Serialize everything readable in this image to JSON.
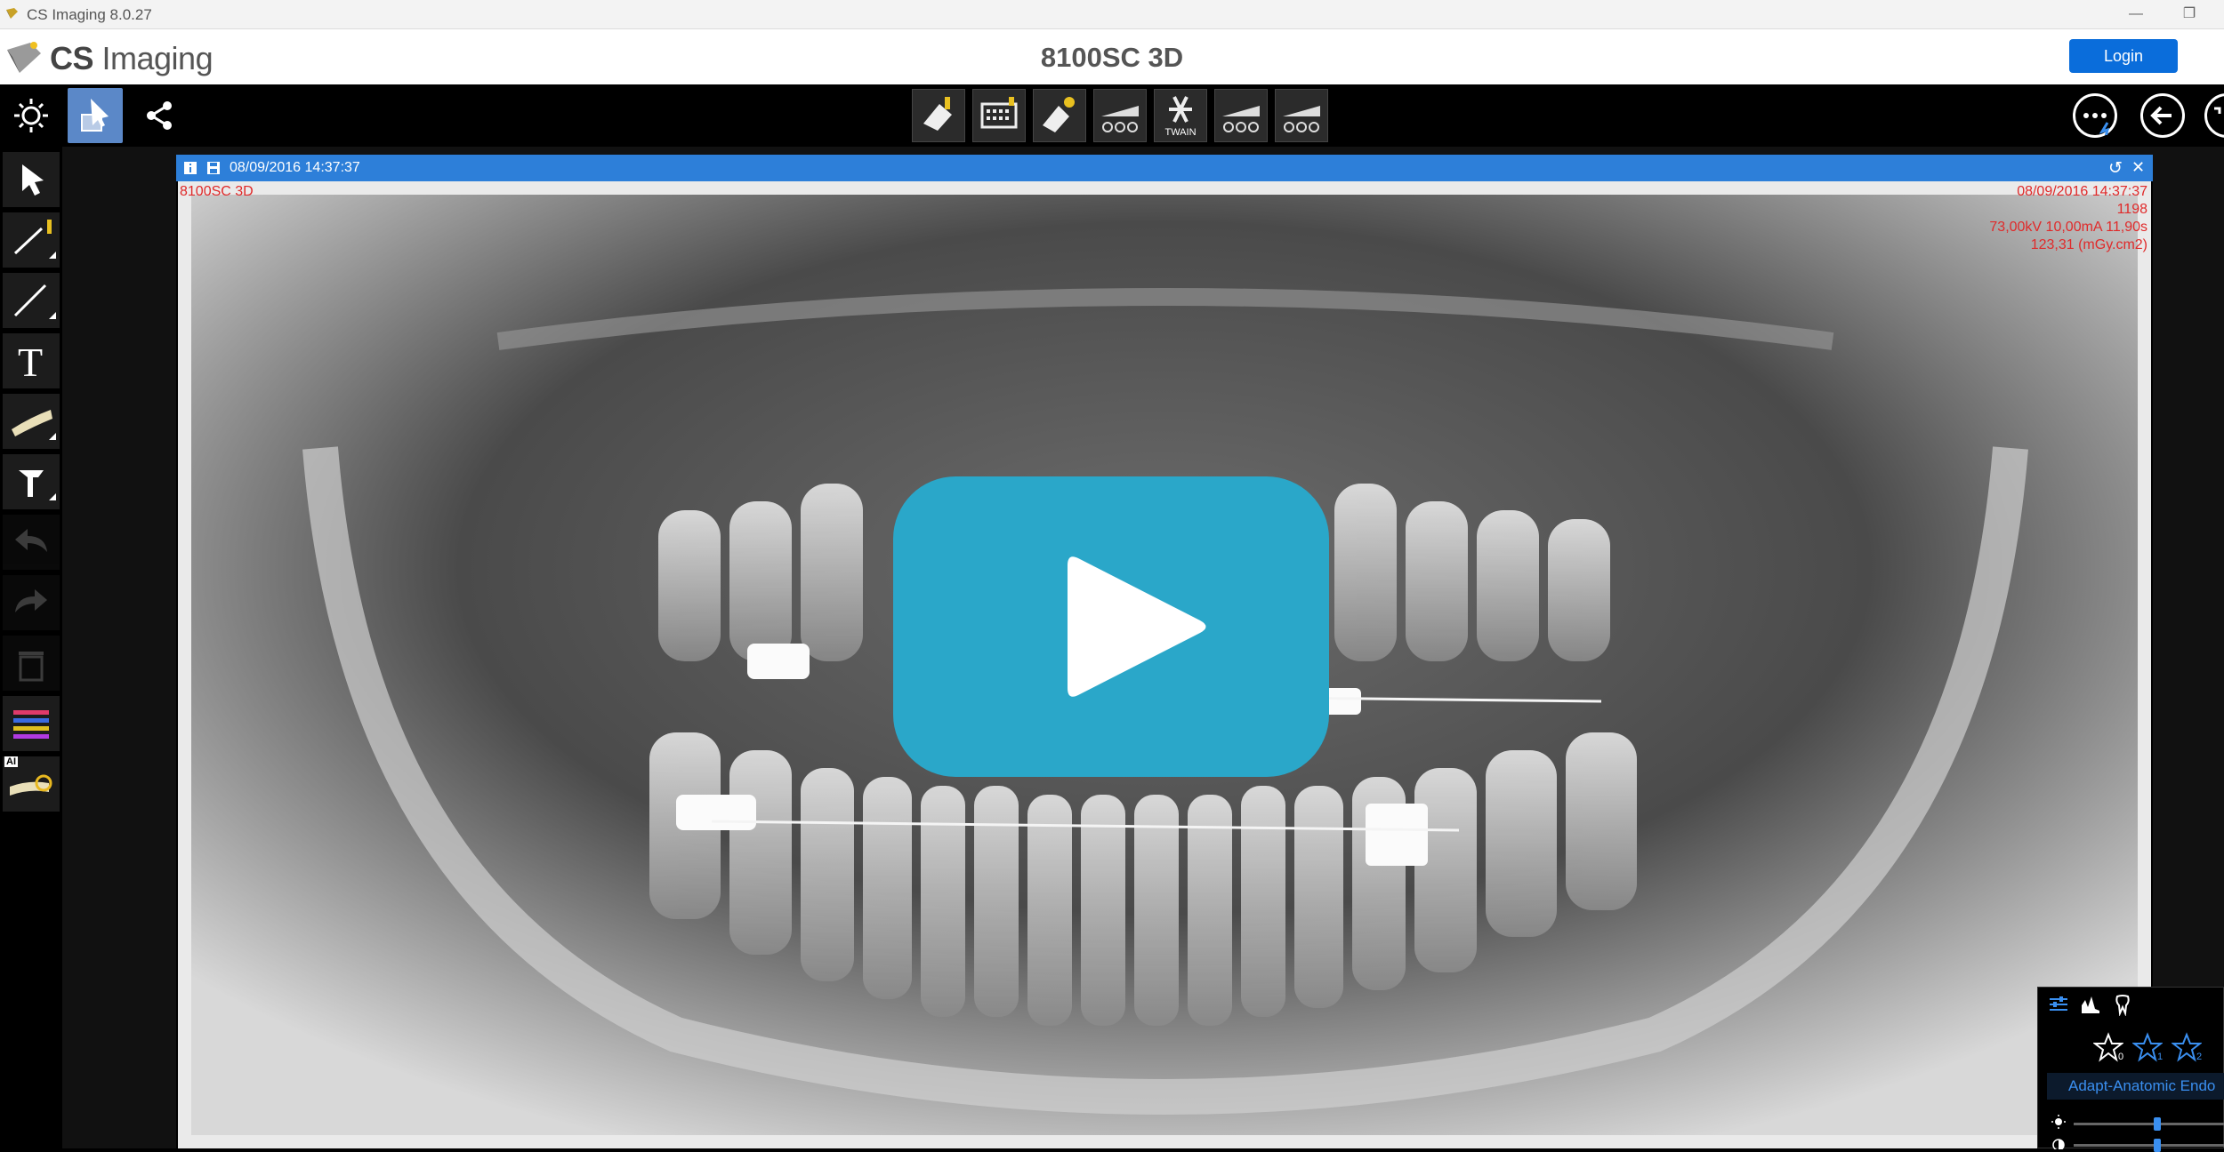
{
  "window": {
    "title": "CS Imaging 8.0.27",
    "minimize": "—",
    "restore": "❐"
  },
  "header": {
    "logo_strong": "CS",
    "logo_light": " Imaging",
    "device_title": "8100SC 3D",
    "login_label": "Login",
    "menu": "⋮"
  },
  "toolbar": {
    "left": [
      {
        "name": "brightness-tool-button",
        "icon": "sun-icon"
      },
      {
        "name": "select-tool-button",
        "icon": "image-select-icon",
        "active": true
      },
      {
        "name": "share-button",
        "icon": "share-icon"
      }
    ],
    "acquisition": [
      {
        "name": "acquire-intraoral-button",
        "icon": "sensor-icon"
      },
      {
        "name": "acquire-scanner-button",
        "icon": "phosphor-scanner-icon"
      },
      {
        "name": "acquire-sensor-settings-button",
        "icon": "sensor-settings-icon"
      },
      {
        "name": "acquire-panoramic-button",
        "icon": "panoramic-icon"
      },
      {
        "name": "twain-button",
        "icon": "twain-icon",
        "label": "TWAIN"
      },
      {
        "name": "acquire-panoramic-2-button",
        "icon": "panoramic-icon"
      },
      {
        "name": "acquire-panoramic-3-button",
        "icon": "panoramic-icon"
      }
    ],
    "right": [
      {
        "name": "more-options-button",
        "icon": "more-icon"
      },
      {
        "name": "back-button",
        "icon": "arrow-left-icon"
      },
      {
        "name": "fullscreen-button",
        "icon": "fullscreen-icon"
      }
    ]
  },
  "left_tools": [
    {
      "name": "pointer-tool",
      "icon": "cursor-icon"
    },
    {
      "name": "measure-calibrated-tool",
      "icon": "ruler-icon"
    },
    {
      "name": "line-tool",
      "icon": "line-icon"
    },
    {
      "name": "text-tool",
      "icon": "text-icon",
      "glyph": "T"
    },
    {
      "name": "jaw-tool",
      "icon": "jaw-icon"
    },
    {
      "name": "implant-tool",
      "icon": "implant-icon"
    },
    {
      "name": "undo-tool",
      "icon": "undo-icon",
      "disabled": true
    },
    {
      "name": "redo-tool",
      "icon": "redo-icon",
      "disabled": true
    },
    {
      "name": "delete-tool",
      "icon": "trash-icon",
      "disabled": true
    },
    {
      "name": "color-tool",
      "icon": "color-lines-icon"
    },
    {
      "name": "ai-tool",
      "icon": "ai-panoramic-icon",
      "badge": "AI"
    }
  ],
  "image_window": {
    "date": "08/09/2016 14:37:37",
    "overlay_left": "8100SC 3D",
    "overlay_right": [
      "08/09/2016 14:37:37",
      "1198",
      "73,00kV 10,00mA 11,90s",
      "123,31 (mGy.cm2)"
    ],
    "refresh": "↺",
    "close": "✕"
  },
  "video": {
    "play_icon": "play-icon",
    "color": "#2aa7c9"
  },
  "panel": {
    "preset_label": "Adapt-Anatomic Endo",
    "tabs": [
      "settings-icon",
      "histogram-icon",
      "tooth-icon"
    ],
    "stars": [
      "0",
      "1",
      "2"
    ]
  },
  "colors": {
    "accent": "#0a6ddb",
    "image_bar": "#2d7fd9",
    "overlay_text": "#e02a2a",
    "active_tool": "#5b88c8"
  }
}
